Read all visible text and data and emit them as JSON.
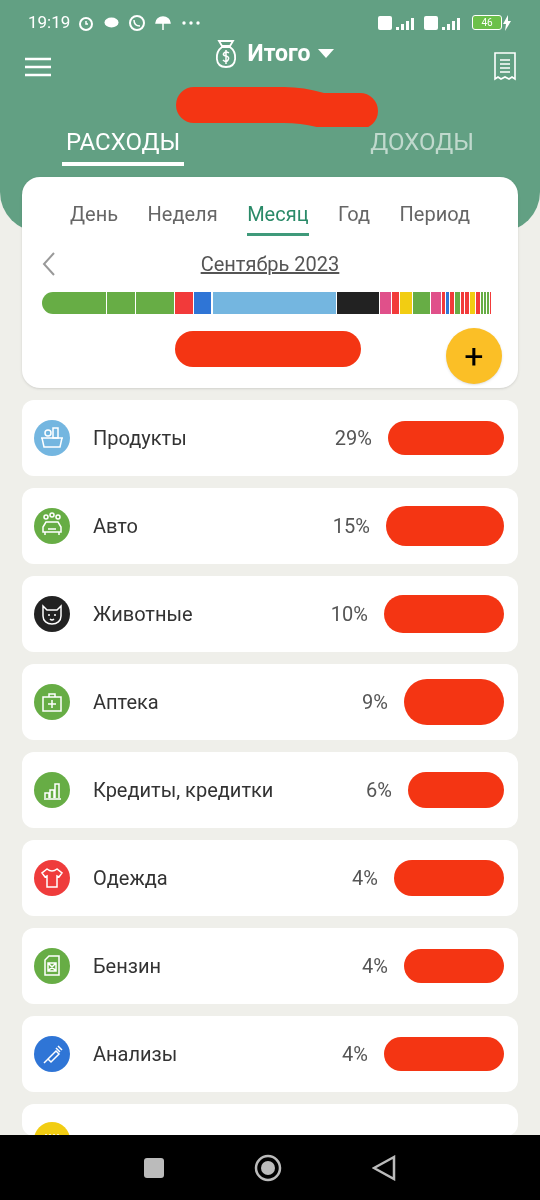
{
  "status_bar": {
    "time": "19:19",
    "battery": "46"
  },
  "header": {
    "title": "Итого"
  },
  "tabs": [
    {
      "label": "РАСХОДЫ",
      "selected": true
    },
    {
      "label": "ДОХОДЫ",
      "selected": false
    }
  ],
  "periods": [
    {
      "label": "День",
      "selected": false
    },
    {
      "label": "Неделя",
      "selected": false
    },
    {
      "label": "Месяц",
      "selected": true
    },
    {
      "label": "Год",
      "selected": false
    },
    {
      "label": "Период",
      "selected": false
    }
  ],
  "month": "Сентябрь 2023",
  "add_button": "+",
  "categories": [
    {
      "name": "Продукты",
      "percent": "29%",
      "color": "#74b6e0"
    },
    {
      "name": "Авто",
      "percent": "15%",
      "color": "#67ad45"
    },
    {
      "name": "Животные",
      "percent": "10%",
      "color": "#222222"
    },
    {
      "name": "Аптека",
      "percent": "9%",
      "color": "#67ad45"
    },
    {
      "name": "Кредиты, кредитки",
      "percent": "6%",
      "color": "#67ad45"
    },
    {
      "name": "Одежда",
      "percent": "4%",
      "color": "#ef3c3c"
    },
    {
      "name": "Бензин",
      "percent": "4%",
      "color": "#67ad45"
    },
    {
      "name": "Анализы",
      "percent": "4%",
      "color": "#2f75d6"
    },
    {
      "color": "#f2cd12"
    }
  ]
}
